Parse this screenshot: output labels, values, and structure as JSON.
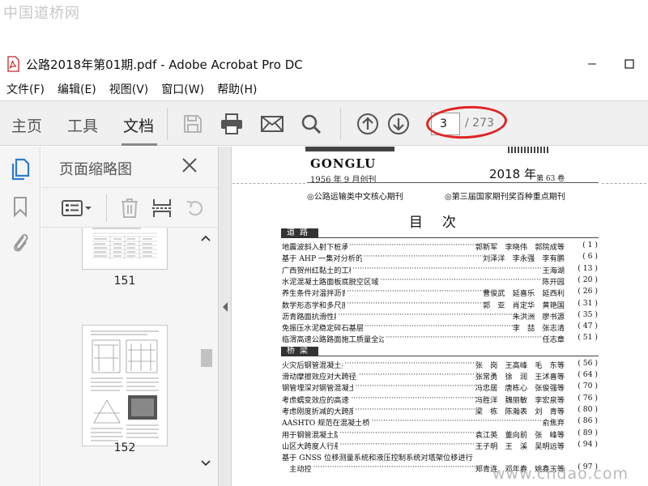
{
  "watermark": {
    "top": "中国道桥网",
    "bottom": "www.cndao.com"
  },
  "window": {
    "title": "公路2018年第01期.pdf - Adobe Acrobat Pro DC",
    "minimize": "—",
    "maximize": "☐"
  },
  "menu": [
    "文件(F)",
    "编辑(E)",
    "视图(V)",
    "窗口(W)",
    "帮助(H)"
  ],
  "toolbar": {
    "tabs": [
      "主页",
      "工具",
      "文档"
    ],
    "active_tab": "文档",
    "page_current": "3",
    "page_total": "/ 273"
  },
  "thumbnails": {
    "title": "页面缩略图",
    "pages": [
      {
        "label": "151"
      },
      {
        "label": "152"
      }
    ]
  },
  "document": {
    "journal": "GONGLU",
    "founded": "1956 年 9 月创刊",
    "year": "2018 年",
    "issue": "第 63 卷",
    "tag_left": "◎公路运输类中文核心期刊",
    "tag_right": "◎第三届国家期刊奖百种重点期刊",
    "toc_title": "目次",
    "sections": [
      {
        "name": "道路",
        "items": [
          {
            "title": "地震波斜入射下桩承式加筋路基动力响应分析",
            "authors": "郭新军　李晓伟　郭院成等",
            "page": "( 1 )"
          },
          {
            "title": "基于 AHP 一集对分析的山区丘陵公路边坡稳定性评价模型",
            "authors": "刘泽洋　李永强　李有鹏",
            "page": "( 6 )"
          },
          {
            "title": "广西贺州红黏土的工程性质研究",
            "authors": "王海湖",
            "page": "( 13 )"
          },
          {
            "title": "水泥混凝土路面板底脱空区域动水压力分布特性研究",
            "authors": "陈开园",
            "page": "( 20 )"
          },
          {
            "title": "养生条件对温拌沥青混合料稳定度的影响",
            "authors": "曹俊武　延喜乐　延西利",
            "page": "( 26 )"
          },
          {
            "title": "数学形态学和多尺度分析的路面裂缝提取",
            "authors": "郭　亚　肖定华　黄艳国",
            "page": "( 31 )"
          },
          {
            "title": "沥青路面抗滑性能研究现状",
            "authors": "朱洪洲　廖书源",
            "page": "( 35 )"
          },
          {
            "title": "免振压水泥稳定碎石基层配合比设计与施工方法",
            "authors": "李　喆　张志清",
            "page": "( 47 )"
          },
          {
            "title": "临渭高速公路路面施工质量全过程动态监控系统应用研究",
            "authors": "任志章",
            "page": "( 51 )"
          }
        ]
      },
      {
        "name": "桥梁",
        "items": [
          {
            "title": "火灾后钢管混凝土拱桥的承载力评估研究",
            "authors": "张　岗　王高峰　毛　东等",
            "page": "( 56 )"
          },
          {
            "title": "滑动摩擦效应对大跨径多跨连续梁桥地震响应的影响研究",
            "authors": "张常勇　徐　润　王沭喜等",
            "page": "( 64 )"
          },
          {
            "title": "钢管埋深对钢管混凝土复合桩竖向承载特性影响研究",
            "authors": "冯忠居　唐栋心　张俊强等",
            "page": "( 70 )"
          },
          {
            "title": "考虑蠕变效应的高速铁路桥梁桩基工后沉降计算",
            "authors": "冯胜洋　魏丽敏　李宏泉等",
            "page": "( 76 )"
          },
          {
            "title": "考虑刚度折减的大跨度波形钢腹板连续梁桥力学性能",
            "authors": "梁　栋　陈瀚表　刘　青等",
            "page": "( 80 )"
          },
          {
            "title": "AASHTO 规范在混凝土桥梁设计的应用指导",
            "authors": "俞焦弃",
            "page": "( 86 )"
          },
          {
            "title": "用于钢管混凝土防脱粘检测的新技术",
            "authors": "袁江英　董向前　张　峰等",
            "page": "( 89 )"
          },
          {
            "title": "山区大跨度人行悬索桥工程地质勘察",
            "authors": "王子明　王　溪　吴明远等",
            "page": "( 94 )"
          },
          {
            "title": "基于 GNSS 位移测量系统和液压控制系统对塔架位移进行",
            "authors": "",
            "page": ""
          },
          {
            "title": "　主动控制研究",
            "authors": "郑青连　邓年春　姚鑫玉等",
            "page": "( 97 )"
          }
        ]
      }
    ]
  },
  "colors": {
    "annotation_oval": "#e02424",
    "toolbar_bg": "#f0f0f0",
    "pdf_red": "#c1272d"
  }
}
